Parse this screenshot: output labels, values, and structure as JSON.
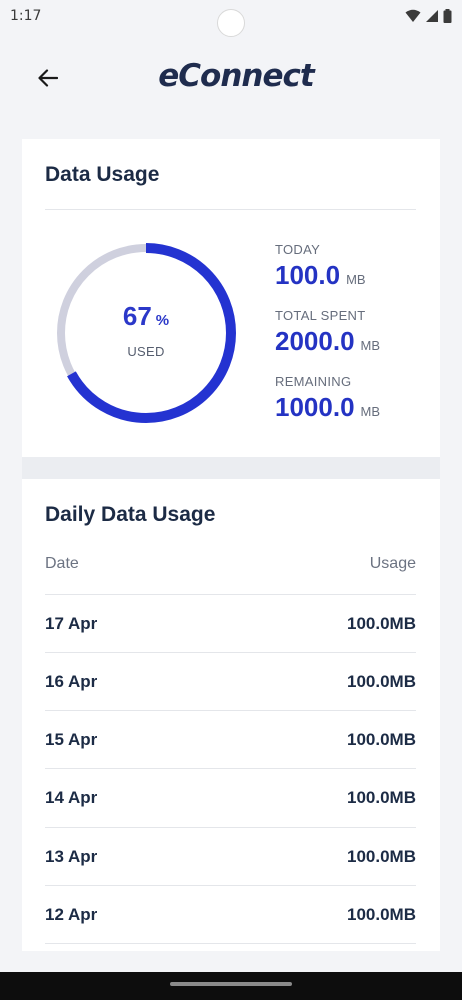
{
  "status_bar": {
    "time": "1:17"
  },
  "header": {
    "logo_text": "eConnect",
    "back_icon": "arrow-left-icon"
  },
  "data_usage": {
    "title": "Data Usage",
    "percent_used": 67,
    "percent_sign": "%",
    "used_label": "USED",
    "stats": [
      {
        "label": "TODAY",
        "value": "100.0",
        "unit": "MB"
      },
      {
        "label": "TOTAL SPENT",
        "value": "2000.0",
        "unit": "MB"
      },
      {
        "label": "REMAINING",
        "value": "1000.0",
        "unit": "MB"
      }
    ],
    "colors": {
      "used": "#2433d1",
      "remaining": "#cfd0de"
    }
  },
  "daily_usage": {
    "title": "Daily Data Usage",
    "columns": [
      "Date",
      "Usage"
    ],
    "rows": [
      {
        "date": "17 Apr",
        "usage": "100.0MB"
      },
      {
        "date": "16 Apr",
        "usage": "100.0MB"
      },
      {
        "date": "15 Apr",
        "usage": "100.0MB"
      },
      {
        "date": "14 Apr",
        "usage": "100.0MB"
      },
      {
        "date": "13 Apr",
        "usage": "100.0MB"
      },
      {
        "date": "12 Apr",
        "usage": "100.0MB"
      }
    ]
  }
}
